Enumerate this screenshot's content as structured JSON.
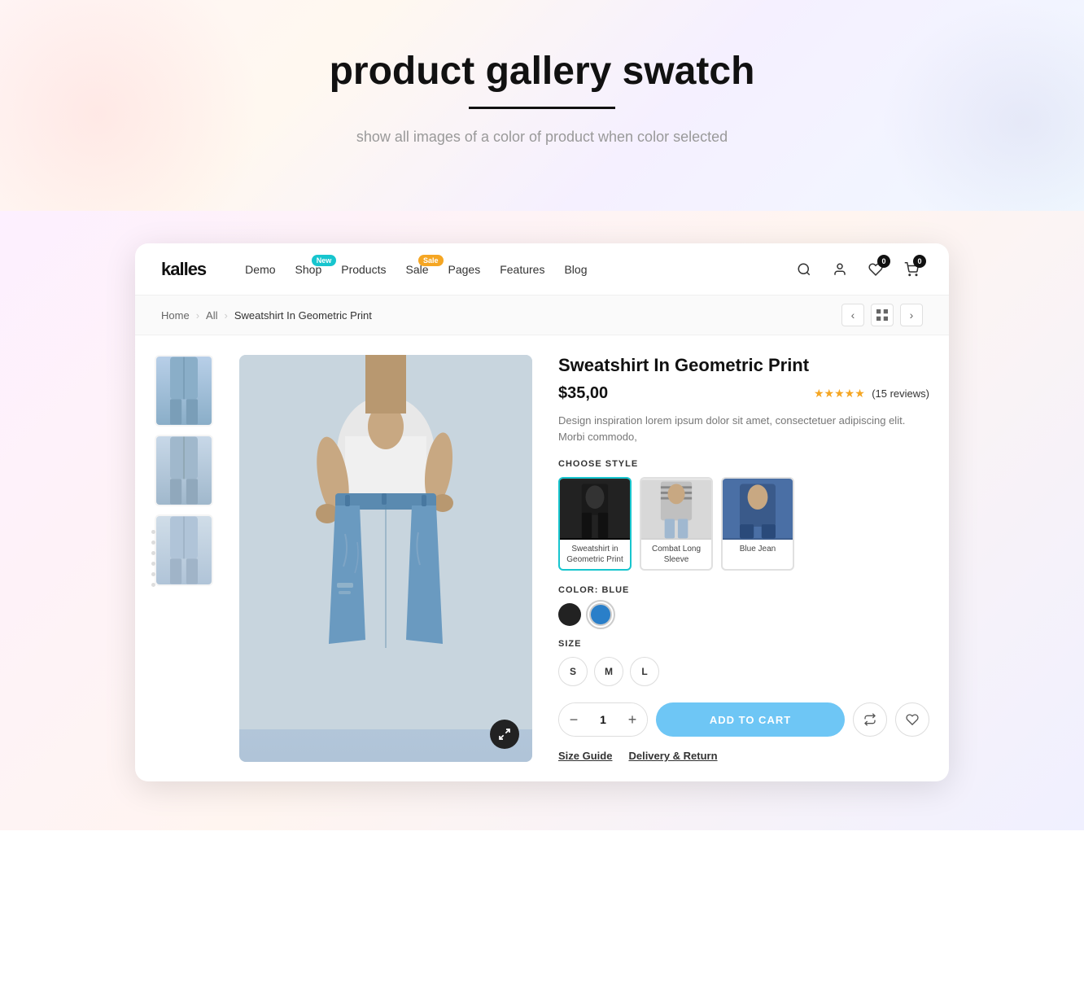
{
  "hero": {
    "title": "product gallery swatch",
    "subtitle": "show all images of a color of product when color selected"
  },
  "nav": {
    "logo": "kalles",
    "links": [
      {
        "label": "Demo",
        "badge": null
      },
      {
        "label": "Shop",
        "badge": "New",
        "badge_type": "new"
      },
      {
        "label": "Products",
        "badge": null
      },
      {
        "label": "Sale",
        "badge": "Sale",
        "badge_type": "sale"
      },
      {
        "label": "Pages",
        "badge": null
      },
      {
        "label": "Features",
        "badge": null
      },
      {
        "label": "Blog",
        "badge": null
      }
    ],
    "cart_count": "0",
    "wishlist_count": "0"
  },
  "breadcrumb": {
    "home": "Home",
    "all": "All",
    "current": "Sweatshirt In Geometric Print"
  },
  "product": {
    "name": "Sweatshirt In Geometric Print",
    "price": "$35,00",
    "rating": "★★★★★",
    "review_count": "(15 reviews)",
    "description": "Design inspiration lorem ipsum dolor sit amet, consectetuer adipiscing elit. Morbi commodo,",
    "choose_style_label": "CHOOSE STYLE",
    "styles": [
      {
        "label": "Sweatshirt in Geometric Print",
        "selected": true
      },
      {
        "label": "Combat Long Sleeve",
        "selected": false
      },
      {
        "label": "Blue Jean",
        "selected": false
      }
    ],
    "color_label": "COLOR: BLUE",
    "colors": [
      {
        "name": "black",
        "hex": "#222222",
        "selected": false
      },
      {
        "name": "blue",
        "hex": "#2a7fc9",
        "selected": true
      }
    ],
    "size_label": "SIZE",
    "sizes": [
      "S",
      "M",
      "L"
    ],
    "quantity": "1",
    "add_to_cart": "ADD TO CART",
    "links": [
      {
        "label": "Size Guide"
      },
      {
        "label": "Delivery & Return"
      }
    ]
  }
}
